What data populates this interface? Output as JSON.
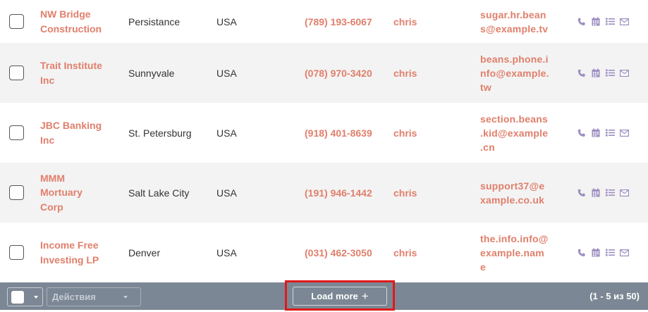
{
  "rows": [
    {
      "name_lines": [
        "NW Bridge",
        "Construction"
      ],
      "city": "Persistance",
      "country": "USA",
      "phone": "(789) 193-6067",
      "user": "chris",
      "email_lines": [
        "sugar.hr.bean",
        "s@example.tv"
      ]
    },
    {
      "name_lines": [
        "Trait Institute",
        "Inc"
      ],
      "city": "Sunnyvale",
      "country": "USA",
      "phone": "(078) 970-3420",
      "user": "chris",
      "email_lines": [
        "beans.phone.i",
        "nfo@example.",
        "tw"
      ]
    },
    {
      "name_lines": [
        "JBC Banking",
        "Inc"
      ],
      "city": "St. Petersburg",
      "country": "USA",
      "phone": "(918) 401-8639",
      "user": "chris",
      "email_lines": [
        "section.beans",
        ".kid@example",
        ".cn"
      ]
    },
    {
      "name_lines": [
        "MMM",
        "Mortuary",
        "Corp"
      ],
      "city": "Salt Lake City",
      "country": "USA",
      "phone": "(191) 946-1442",
      "user": "chris",
      "email_lines": [
        "support37@e",
        "xample.co.uk"
      ]
    },
    {
      "name_lines": [
        "Income Free",
        "Investing LP"
      ],
      "city": "Denver",
      "country": "USA",
      "phone": "(031) 462-3050",
      "user": "chris",
      "email_lines": [
        "the.info.info@",
        "example.nam",
        "e"
      ]
    }
  ],
  "row_icons": [
    "phone-icon",
    "calendar-icon",
    "tasks-icon",
    "email-icon"
  ],
  "footer": {
    "actions_label": "Действия",
    "load_more_label": "Load more",
    "load_more_icon": "+",
    "pagination": "(1 - 5 из 50)"
  },
  "colors": {
    "accent": "#e07f6b",
    "icon": "#9d8fc1",
    "footer": "#7b8794",
    "highlight": "#e01818"
  }
}
